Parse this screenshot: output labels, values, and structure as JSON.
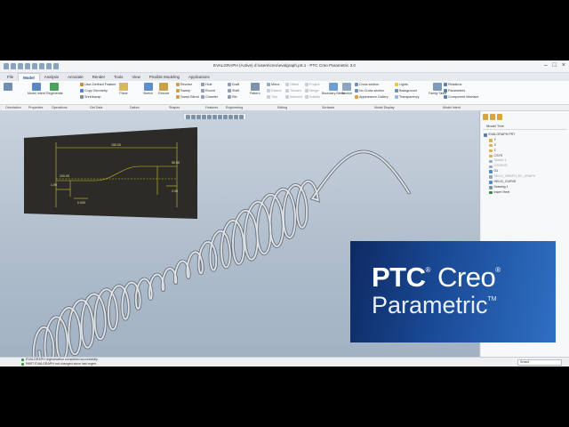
{
  "window": {
    "title": "EVALGRAPH (Active) d:\\users\\creo\\evalgraph.prt.1 - PTC Creo Parametric 3.0"
  },
  "tabs": [
    "File",
    "Model",
    "Analysis",
    "Annotate",
    "Render",
    "Tools",
    "View",
    "Flexible Modeling",
    "Applications"
  ],
  "active_tab": "Model",
  "ribbon": {
    "model_intent": "Model Intent",
    "regenerate": "Regenerate",
    "user_defined_feature": "User-Defined Feature",
    "copy_geometry": "Copy Geometry",
    "shrinkwrap": "Shrinkwrap",
    "plane": "Plane",
    "sketch": "Sketch",
    "extrude": "Extrude",
    "revolve": "Revolve",
    "sweep": "Sweep",
    "swept_blend": "Swept Blend",
    "hole": "Hole",
    "round": "Round",
    "chamfer": "Chamfer",
    "draft": "Draft",
    "shell": "Shell",
    "rib": "Rib",
    "pattern": "Pattern",
    "mirror": "Mirror",
    "extend": "Extend",
    "project": "Project",
    "trim": "Trim",
    "offset": "Offset",
    "thicken": "Thicken",
    "merge": "Merge",
    "intersect": "Intersect",
    "solidify": "Solidify",
    "boundary_blend": "Boundary Blend",
    "section": "Section",
    "cross_section": "Cross section",
    "no_cross_section": "No Cross section",
    "appearance_gallery": "Appearance Gallery",
    "lights": "Lights",
    "background": "Background",
    "transparency": "Transparency",
    "family_table": "Family Table",
    "relations": "Relations",
    "parameters": "Parameters",
    "component_interface": "Component Interface"
  },
  "group_labels": [
    "Orientation",
    "Properties",
    "Operations",
    "Get Data",
    "Datum",
    "Shapes",
    "Features",
    "Engineering",
    "Editing",
    "Surfaces",
    "Model Display",
    "Model Intent"
  ],
  "model_tree": {
    "header": "Model Tree",
    "items": [
      {
        "label": "EVALGRAPH.PRT",
        "dim": false
      },
      {
        "label": "Y",
        "dim": false
      },
      {
        "label": "X",
        "dim": false
      },
      {
        "label": "Z",
        "dim": false
      },
      {
        "label": "CSYS",
        "dim": false
      },
      {
        "label": "Sketch 1",
        "dim": true
      },
      {
        "label": "CS0/EVB",
        "dim": true
      },
      {
        "label": "G1",
        "dim": false
      },
      {
        "label": "HELIX_GRAPH_BY_GRAPH",
        "dim": true
      },
      {
        "label": "HELIX_CURVE",
        "dim": false
      },
      {
        "label": "Drawing 1",
        "dim": false
      },
      {
        "label": "Insert Here",
        "dim": false
      }
    ]
  },
  "status": {
    "line1": "EVALGRAPH regeneration completed successfully.",
    "line2": "PART EVALGRAPH not changed since last regen.",
    "filter": "Smart"
  },
  "overlay": {
    "brand_ptc": "PTC",
    "brand_creo": "Creo",
    "product": "Parametric",
    "registered_mark": "®",
    "trademark": "TM"
  },
  "sketch": {
    "dim_top": "150.00",
    "dim_left": "1.00",
    "dim_mid": "100.00",
    "dim_r1": "50.00",
    "dim_r2": "2.00",
    "dim_bottom": "0.000"
  },
  "colors": {
    "accent": "#1f4e87",
    "background_top": "#c9d3dd",
    "background_bottom": "#a2b2c4",
    "overlay_dark": "#0e2a63",
    "overlay_light": "#2f6fc3"
  }
}
